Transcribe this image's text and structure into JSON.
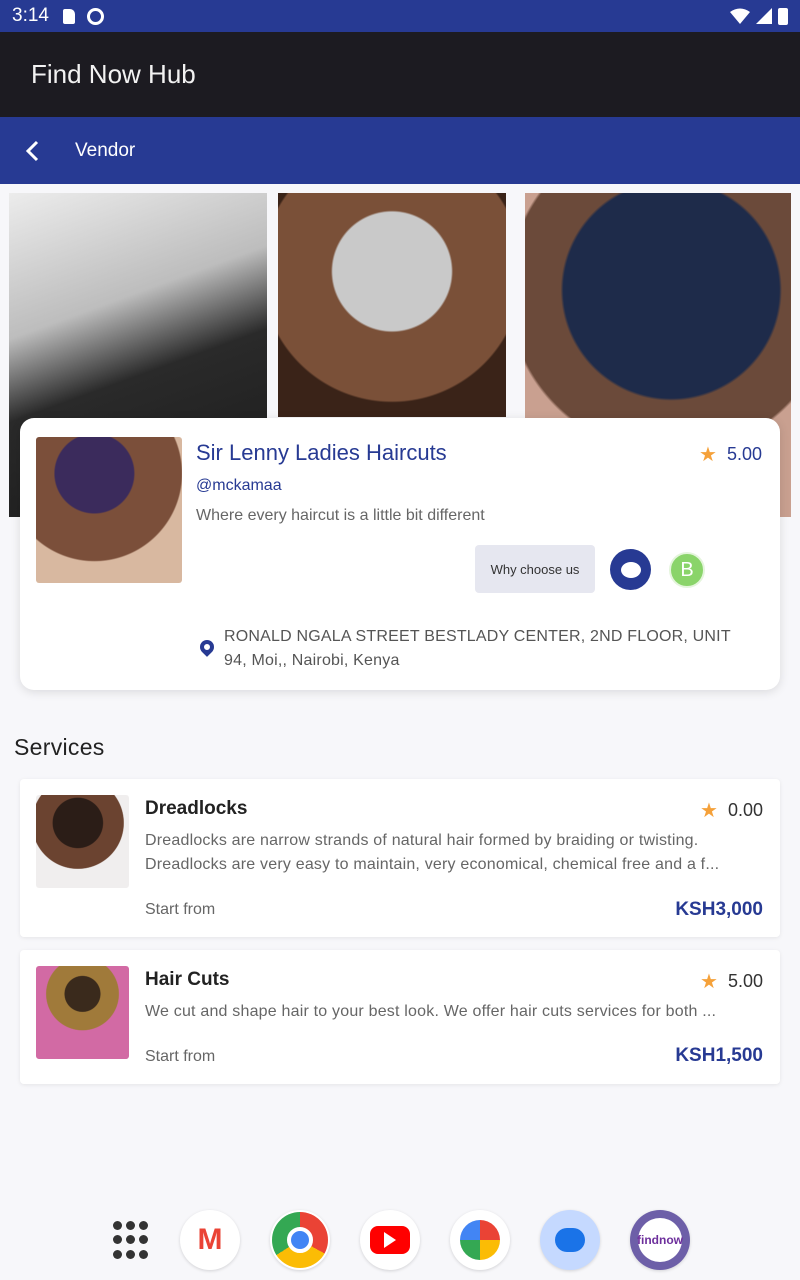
{
  "status_bar": {
    "time": "3:14"
  },
  "app_bar": {
    "title": "Find Now Hub"
  },
  "nav": {
    "title": "Vendor"
  },
  "vendor": {
    "name": "Sir Lenny Ladies Haircuts",
    "handle": "@mckamaa",
    "tagline": "Where every haircut is a little bit different",
    "rating": "5.00",
    "why_label": "Why choose us",
    "whatsapp_letter": "B",
    "address": "RONALD NGALA STREET BESTLADY CENTER,  2ND FLOOR,  UNIT 94, Moi,, Nairobi, Kenya"
  },
  "services": {
    "heading": "Services",
    "items": [
      {
        "title": "Dreadlocks",
        "rating": "0.00",
        "description": "Dreadlocks are narrow strands of natural hair formed by braiding or twisting. Dreadlocks are very easy to maintain, very economical, chemical free and a f...",
        "start_label": "Start from",
        "price": "KSH3,000"
      },
      {
        "title": "Hair Cuts",
        "rating": "5.00",
        "description": "We cut and shape hair to your best look. We offer hair cuts services for both ...",
        "start_label": "Start from",
        "price": "KSH1,500"
      }
    ]
  },
  "dock": {
    "gmail_letter": "M",
    "fnh_logo_text": "findnow"
  },
  "colors": {
    "primary": "#273a93",
    "star": "#f5a13a",
    "app_bar": "#1c1b21"
  }
}
